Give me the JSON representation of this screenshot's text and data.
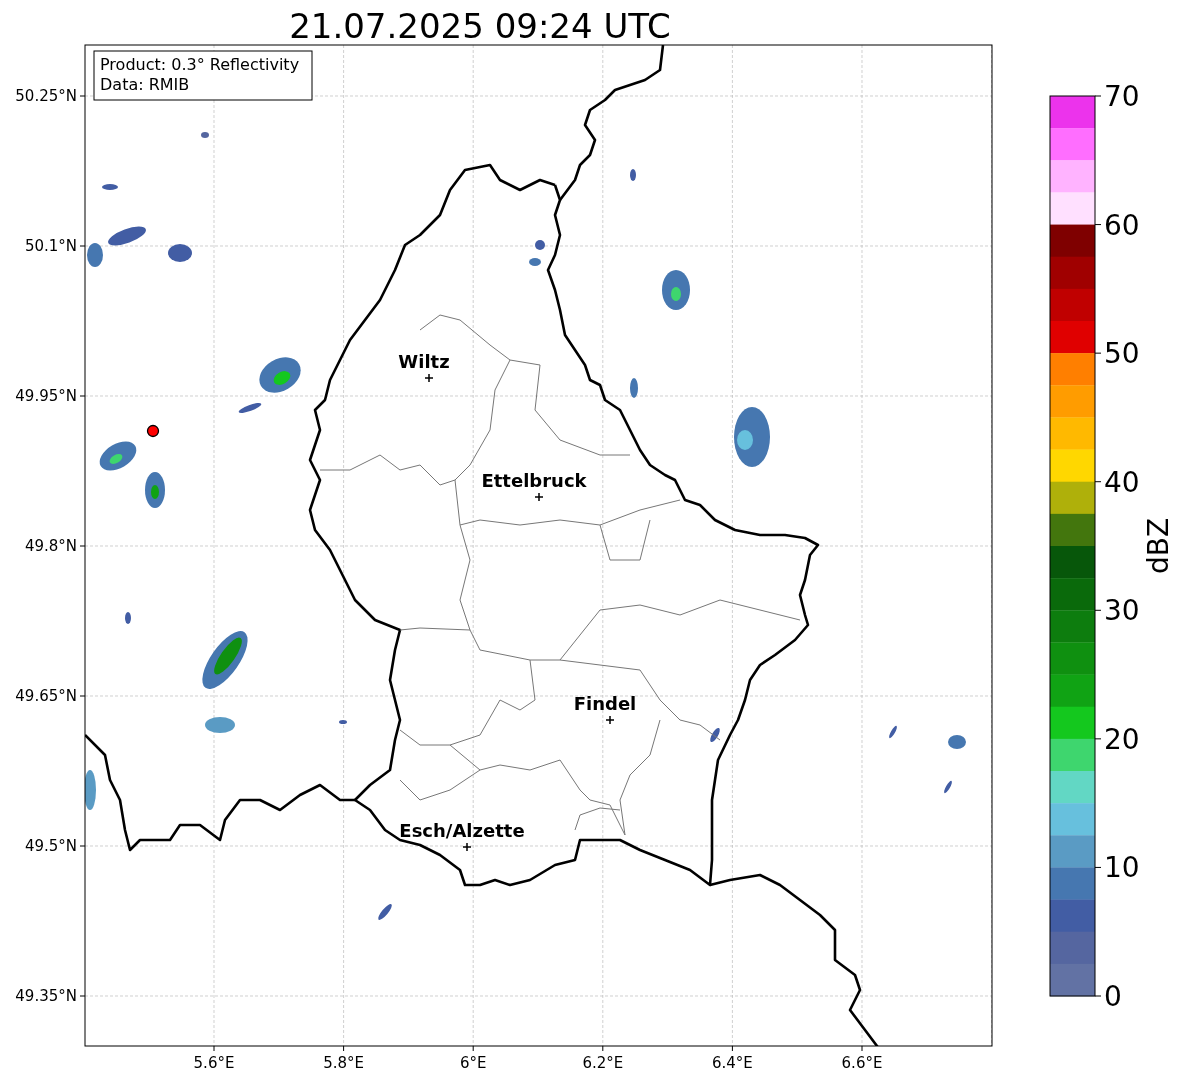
{
  "title": "21.07.2025 09:24 UTC",
  "map": {
    "legend": [
      "Product: 0.3° Reflectivity",
      "Data: RMIB"
    ],
    "lat_ticks": [
      "50.25°N",
      "50.1°N",
      "49.95°N",
      "49.8°N",
      "49.65°N",
      "49.5°N",
      "49.35°N"
    ],
    "lon_ticks": [
      "5.6°E",
      "5.8°E",
      "6°E",
      "6.2°E",
      "6.4°E",
      "6.6°E"
    ],
    "cities": [
      {
        "name": "Wiltz"
      },
      {
        "name": "Ettelbruck"
      },
      {
        "name": "Findel"
      },
      {
        "name": "Esch/Alzette"
      }
    ]
  },
  "colorbar": {
    "label": "dBZ",
    "ticks": [
      "70",
      "60",
      "50",
      "40",
      "30",
      "20",
      "10",
      "0"
    ],
    "bins": [
      {
        "color": "#ec33ec"
      },
      {
        "color": "#ff6eff"
      },
      {
        "color": "#ffb3ff"
      },
      {
        "color": "#ffe0ff"
      },
      {
        "color": "#7f0000"
      },
      {
        "color": "#a00000"
      },
      {
        "color": "#c00000"
      },
      {
        "color": "#e00000"
      },
      {
        "color": "#ff7f00"
      },
      {
        "color": "#ff9c00"
      },
      {
        "color": "#ffb900"
      },
      {
        "color": "#ffd700"
      },
      {
        "color": "#afb00a"
      },
      {
        "color": "#43760d"
      },
      {
        "color": "#07570a"
      },
      {
        "color": "#0a6a0b"
      },
      {
        "color": "#0d7d0e"
      },
      {
        "color": "#0f9010"
      },
      {
        "color": "#10a314"
      },
      {
        "color": "#14c81e"
      },
      {
        "color": "#3ed66e"
      },
      {
        "color": "#62d7c4"
      },
      {
        "color": "#67c0dd"
      },
      {
        "color": "#5a9bc4"
      },
      {
        "color": "#4677b0"
      },
      {
        "color": "#425da4"
      },
      {
        "color": "#5566a0"
      },
      {
        "color": "#6272a4"
      }
    ]
  }
}
